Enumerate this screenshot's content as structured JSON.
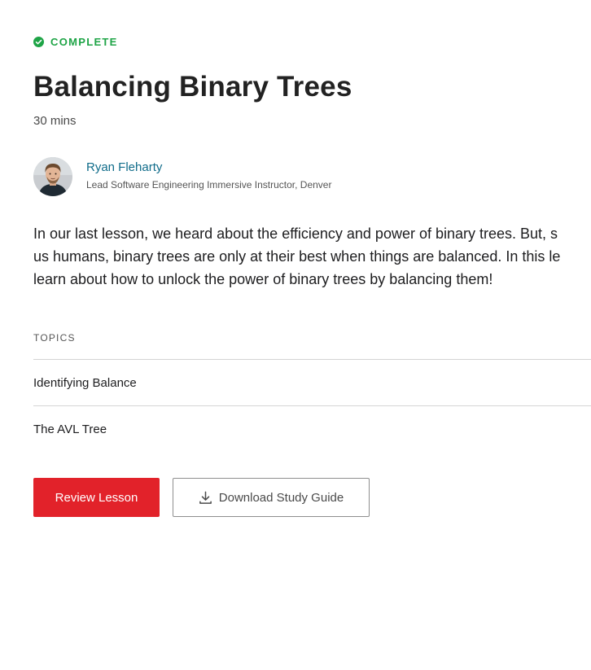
{
  "lesson": {
    "status": "COMPLETE",
    "status_color": "#1ea446",
    "status_icon": "check-circle-icon",
    "title": "Balancing Binary Trees",
    "duration": "30 mins"
  },
  "instructor": {
    "name": "Ryan Fleharty",
    "role": "Lead Software Engineering Immersive Instructor, Denver",
    "avatar": "avatar-photo",
    "name_color": "#106c8a"
  },
  "description": {
    "lines": [
      "In our last lesson, we heard about the efficiency and power of binary trees. But, s",
      "us humans, binary trees are only at their best when things are balanced. In this le",
      "learn about how to unlock the power of binary trees by balancing them!"
    ]
  },
  "topics": {
    "header": "TOPICS",
    "items": [
      "Identifying Balance",
      "The AVL Tree"
    ]
  },
  "actions": {
    "review_label": "Review Lesson",
    "review_color": "#e2222a",
    "download_label": "Download Study Guide",
    "download_icon": "download-icon"
  }
}
